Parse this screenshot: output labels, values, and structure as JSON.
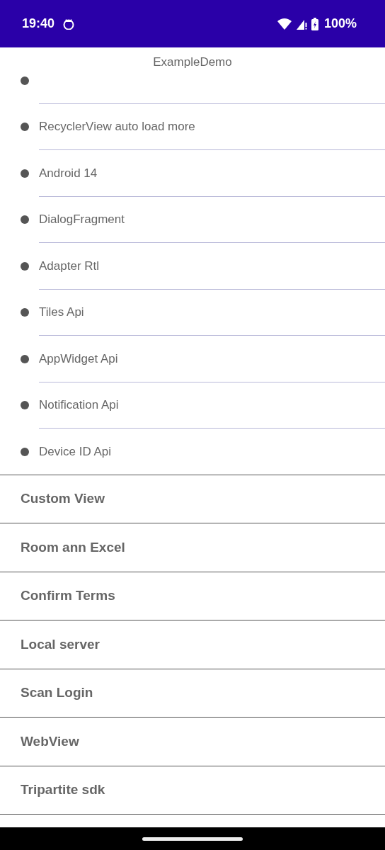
{
  "status_bar": {
    "time": "19:40",
    "battery": "100%"
  },
  "title": "ExampleDemo",
  "sub_items": [
    "RecyclerView auto load more",
    "Android 14",
    "DialogFragment",
    "Adapter Rtl",
    "Tiles Api",
    "AppWidget Api",
    "Notification Api",
    "Device ID Api"
  ],
  "sections": [
    "Custom View",
    "Room ann Excel",
    "Confirm Terms",
    "Local server",
    "Scan Login",
    "WebView",
    "Tripartite sdk"
  ]
}
